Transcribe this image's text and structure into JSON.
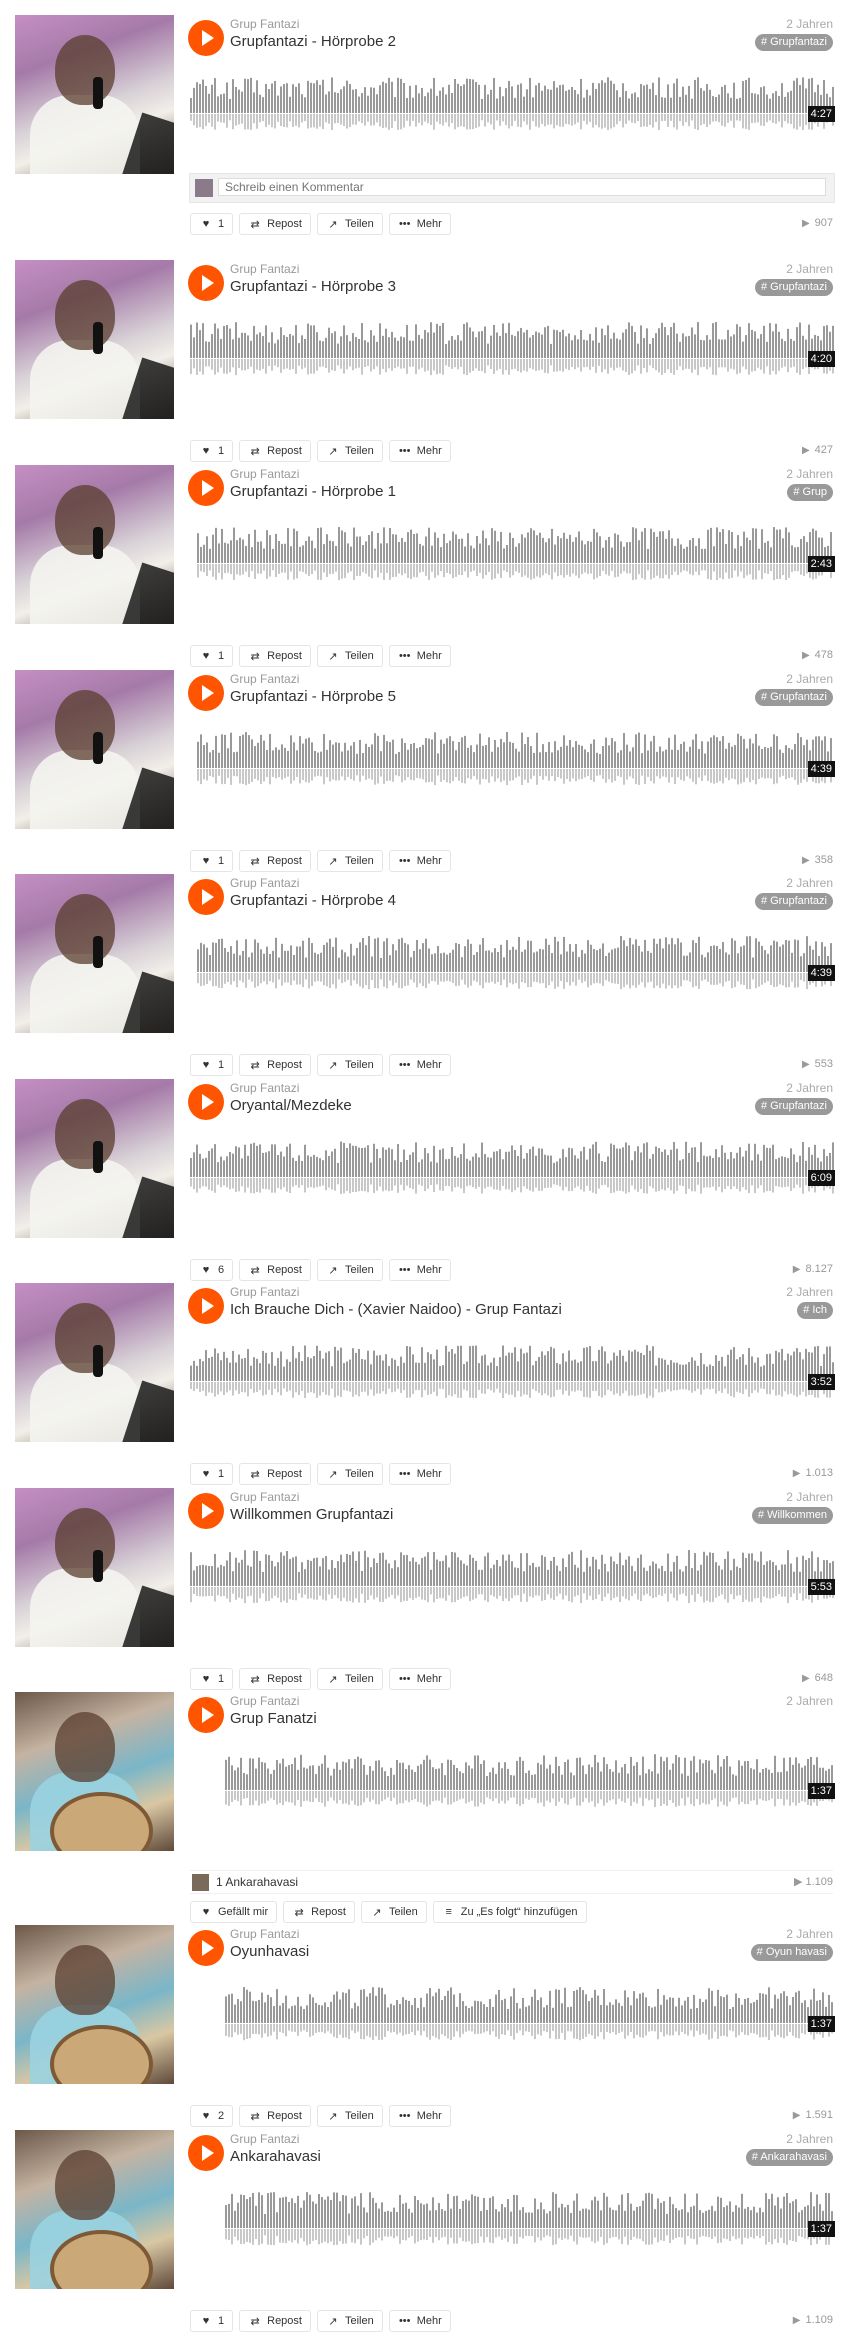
{
  "ui": {
    "repost_label": "Repost",
    "share_label": "Teilen",
    "more_label": "Mehr",
    "like_text_label": "Gefällt mir",
    "add_next_label": "Zu „Es folgt“ hinzufügen",
    "comment_placeholder": "Schreib einen Kommentar",
    "accent": "#ff5500",
    "tag_bg": "#999999",
    "wave_color": "#999999"
  },
  "tracks": [
    {
      "uploader": "Grup Fantazi",
      "title": "Grupfantazi - Hörprobe 2",
      "age": "2 Jahren",
      "tag": "# Grupfantazi",
      "duration": "4:27",
      "likes": "1",
      "plays": "907",
      "art": "pinkish"
    },
    {
      "uploader": "Grup Fantazi",
      "title": "Grupfantazi - Hörprobe 3",
      "age": "2 Jahren",
      "tag": "# Grupfantazi",
      "duration": "4:20",
      "likes": "1",
      "plays": "427",
      "art": "pinkish"
    },
    {
      "uploader": "Grup Fantazi",
      "title": "Grupfantazi - Hörprobe 1",
      "age": "2 Jahren",
      "tag": "# Grup",
      "duration": "2:43",
      "likes": "1",
      "plays": "478",
      "art": "pinkish"
    },
    {
      "uploader": "Grup Fantazi",
      "title": "Grupfantazi - Hörprobe 5",
      "age": "2 Jahren",
      "tag": "# Grupfantazi",
      "duration": "4:39",
      "likes": "1",
      "plays": "358",
      "art": "pinkish"
    },
    {
      "uploader": "Grup Fantazi",
      "title": "Grupfantazi - Hörprobe 4",
      "age": "2 Jahren",
      "tag": "# Grupfantazi",
      "duration": "4:39",
      "likes": "1",
      "plays": "553",
      "art": "pinkish"
    },
    {
      "uploader": "Grup Fantazi",
      "title": "Oryantal/Mezdeke",
      "age": "2 Jahren",
      "tag": "# Grupfantazi",
      "duration": "6:09",
      "likes": "6",
      "plays": "8.127",
      "art": "pinkish"
    },
    {
      "uploader": "Grup Fantazi",
      "title": "Ich Brauche Dich - (Xavier Naidoo) - Grup Fantazi",
      "age": "2 Jahren",
      "tag": "# Ich",
      "duration": "3:52",
      "likes": "1",
      "plays": "1.013",
      "art": "pinkish"
    },
    {
      "uploader": "Grup Fantazi",
      "title": "Willkommen Grupfantazi",
      "age": "2 Jahren",
      "tag": "# Willkommen",
      "duration": "5:53",
      "likes": "1",
      "plays": "648",
      "art": "pinkish"
    },
    {
      "uploader": "Grup Fantazi",
      "title": "Grup Fanatzi",
      "age": "2 Jahren",
      "tag": "",
      "duration": "1:37",
      "likes": "",
      "plays": "",
      "art": "party",
      "related_label": "1 Ankarahavasi",
      "related_plays": "1.109"
    },
    {
      "uploader": "Grup Fantazi",
      "title": "Oyunhavasi",
      "age": "2 Jahren",
      "tag": "# Oyun havasi",
      "duration": "1:37",
      "likes": "2",
      "plays": "1.591",
      "art": "party"
    },
    {
      "uploader": "Grup Fantazi",
      "title": "Ankarahavasi",
      "age": "2 Jahren",
      "tag": "# Ankarahavasi",
      "duration": "1:37",
      "likes": "1",
      "plays": "1.109",
      "art": "party"
    }
  ]
}
